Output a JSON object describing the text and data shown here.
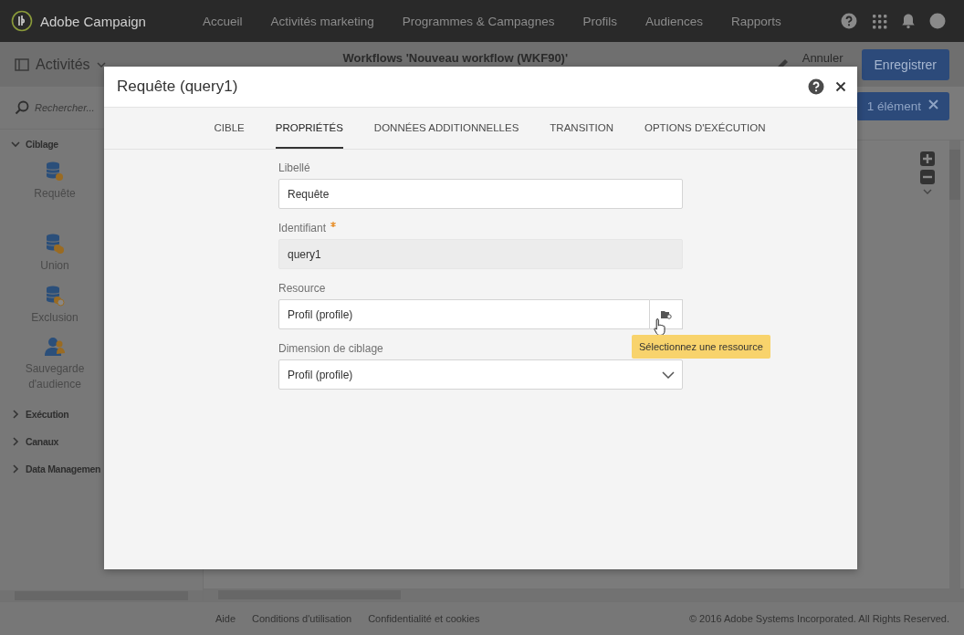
{
  "topbar": {
    "brand": "Adobe Campaign",
    "nav": [
      "Accueil",
      "Activités marketing",
      "Programmes & Campagnes",
      "Profils",
      "Audiences",
      "Rapports"
    ]
  },
  "subbar": {
    "menu_label": "Activités",
    "workflow_title": "Workflows 'Nouveau workflow (WKF90)'",
    "cancel": "Annuler",
    "save": "Enregistrer"
  },
  "selection": {
    "label": "1 élément"
  },
  "sidebar": {
    "search_placeholder": "Rechercher...",
    "groups": [
      {
        "label": "Ciblage",
        "expanded": true,
        "items": [
          {
            "kind": "query",
            "label": "Requête"
          },
          {
            "kind": "union",
            "label": "Union"
          },
          {
            "kind": "exclusion",
            "label": "Exclusion"
          },
          {
            "kind": "audience",
            "label": "Sauvegarde d'audience"
          }
        ]
      },
      {
        "label": "Exécution",
        "expanded": false
      },
      {
        "label": "Canaux",
        "expanded": false
      },
      {
        "label": "Data Managemen",
        "expanded": false
      }
    ]
  },
  "dialog": {
    "title": "Requête (query1)",
    "tabs": [
      {
        "label": "CIBLE",
        "selected": false
      },
      {
        "label": "PROPRIÉTÉS",
        "selected": true
      },
      {
        "label": "DONNÉES ADDITIONNELLES",
        "selected": false
      },
      {
        "label": "TRANSITION",
        "selected": false
      },
      {
        "label": "OPTIONS D'EXÉCUTION",
        "selected": false
      }
    ],
    "fields": [
      {
        "kind": "text",
        "label": "Libellé",
        "value": "Requête",
        "required": false,
        "disabled": false
      },
      {
        "kind": "text",
        "label": "Identifiant",
        "value": "query1",
        "required": true,
        "disabled": true
      },
      {
        "kind": "picker",
        "label": "Resource",
        "value": "Profil (profile)",
        "required": false,
        "disabled": false,
        "tooltip": "Sélectionnez une ressource"
      },
      {
        "kind": "select",
        "label": "Dimension de ciblage",
        "value": "Profil (profile)",
        "required": false,
        "disabled": false
      }
    ]
  },
  "footer": {
    "links": [
      "Aide",
      "Conditions d'utilisation",
      "Confidentialité et cookies"
    ],
    "copyright": "© 2016 Adobe Systems Incorporated. All Rights Reserved."
  }
}
